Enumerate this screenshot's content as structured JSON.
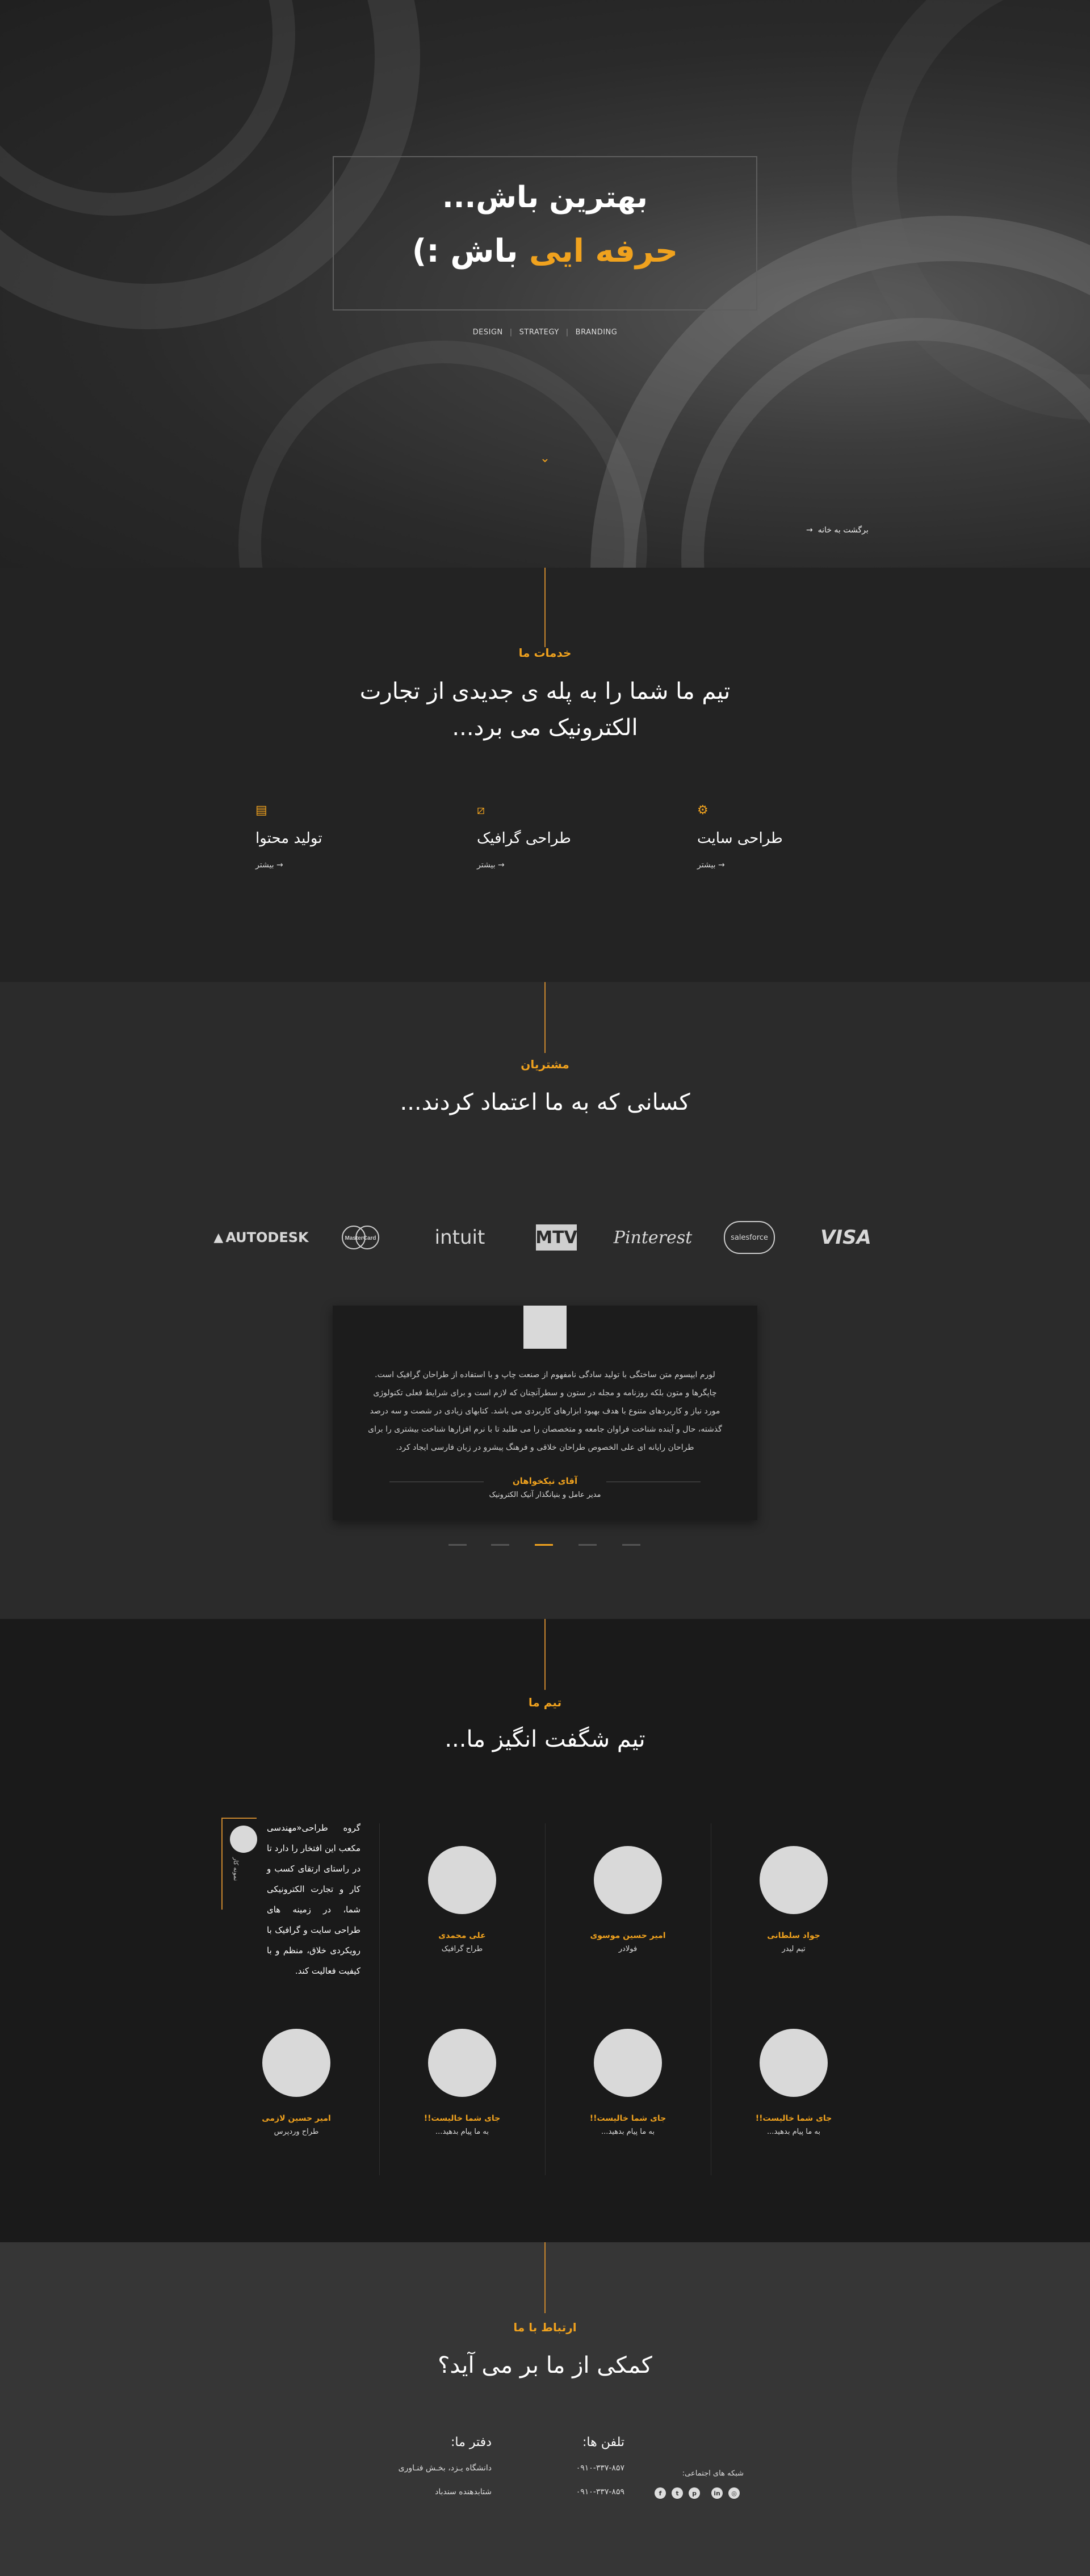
{
  "hero": {
    "title_line1": "بهترین باش...",
    "title_part_orange": "حرفه ایی",
    "title_part_white": " باش :)",
    "tags": [
      "DESIGN",
      "STRATEGY",
      "BRANDING"
    ],
    "scroll_icon": "chevron-down-icon",
    "back_link": "برگشت به خانه",
    "back_arrow": "→"
  },
  "services": {
    "label": "خدمات ما",
    "heading_line1": "تیم ما شما را به پله ی جدیدی از تجارت",
    "heading_line2": "الکترونیک می برد...",
    "items": [
      {
        "icon": "document-icon",
        "title": "تولید محتوا",
        "more": "بیشتر"
      },
      {
        "icon": "graphic-design-icon",
        "title": "طراحی گرافیک",
        "more": "بیشتر"
      },
      {
        "icon": "website-design-icon",
        "title": "طراحی سایت",
        "more": "بیشتر"
      }
    ],
    "more_arrow": "→"
  },
  "clients": {
    "label": "مشتریان",
    "heading": "کسانی که به ما اعتماد کردند...",
    "logos": [
      "AUTODESK",
      "MasterCard",
      "intuit",
      "MTV",
      "Pinterest",
      "salesforce",
      "VISA"
    ],
    "testimonial": {
      "text": "لورم ایپسوم متن ساختگی با تولید سادگی نامفهوم از صنعت چاپ و با استفاده از طراحان گرافیک است. چاپگرها و متون بلکه روزنامه و مجله در ستون و سطرآنچنان که لازم است و برای شرایط فعلی تکنولوژی مورد نیاز و کاربردهای متنوع با هدف بهبود ابزارهای کاربردی می باشد. کتابهای زیادی در شصت و سه درصد گذشته، حال و آینده شناخت فراوان جامعه و متخصصان را می طلبد تا با نرم افزارها شناخت بیشتری را برای طراحان رایانه ای علی الخصوص طراحان خلاقی و فرهنگ پیشرو در زبان فارسی ایجاد کرد.",
      "name": "آقای نیکخواهان",
      "role": "مدیر عامل و بنیانگذار آنیک الکترونیک"
    }
  },
  "team": {
    "label": "تیم ما",
    "heading": "تیم شگفت  انگیز ما...",
    "intro_text": "گروه طراحی«مهندسی مکعب این افتخار را دارد تا در راستای ارتقای کسب و کار و تجارت الکترونیکی شما، در زمینه های طراحی سایت و گرافیک با رویکردی خلاق، منظم و با کیفیت فعالیت کند.",
    "intro_vertical": "نمونه کار",
    "members": [
      {
        "name": "جواد سلطانی",
        "role": "تیم لیدر"
      },
      {
        "name": "امیر حسین موسوی",
        "role": "فولادر"
      },
      {
        "name": "علی محمدی",
        "role": "طراح گرافیک"
      },
      {
        "name": "جای شما خالیست!!",
        "role": "به ما پیام بدهید..."
      },
      {
        "name": "جای شما خالیست!!",
        "role": "به ما پیام بدهید..."
      },
      {
        "name": "جای شما خالیست!!",
        "role": "به ما پیام بدهید..."
      },
      {
        "name": "امیر حسین لازمی",
        "role": "طراح وردپرس"
      }
    ]
  },
  "contact": {
    "label": "ارتباط با ما",
    "heading": "کمکی از ما بر می آید؟",
    "phones_title": "تلفن ها:",
    "phones": [
      "۰۹۱۰-۳۳۷-۸۵۷",
      "۰۹۱۰-۳۳۷-۸۵۹"
    ],
    "office_title": "دفتر ما:",
    "office_lines": [
      "دانشگاه یـزد، بخـش فنـاوری",
      "شتابدهنده سندباد"
    ],
    "social_title": "شبکه های اجتماعی:",
    "social_icons": [
      "facebook-icon",
      "twitter-icon",
      "pinterest-icon",
      "linkedin-icon",
      "instagram-icon"
    ],
    "accent_color": "#f0a21e"
  }
}
